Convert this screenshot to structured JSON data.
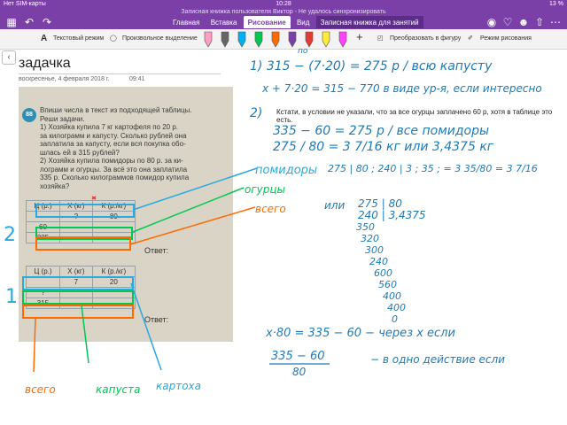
{
  "status": {
    "carrier": "Нет SIM-карты",
    "time": "10:28",
    "battery": "13 %"
  },
  "document": {
    "title": "Записная книжка пользователя Виктор - Не удалось синхронизировать"
  },
  "tabs": [
    "Главная",
    "Вставка",
    "Рисование",
    "Вид",
    "Записная книжка для занятий"
  ],
  "active_tab": "Рисование",
  "ribbon": {
    "text_mode": "Текстовый режим",
    "free_select": "Произвольное выделение",
    "convert": "Преобразовать в фигуру",
    "draw_mode": "Режим рисования"
  },
  "pens": [
    {
      "color": "#ff9fc4"
    },
    {
      "color": "#666666"
    },
    {
      "color": "#00b0f0"
    },
    {
      "color": "#00c853"
    },
    {
      "color": "#ff6a00"
    },
    {
      "color": "#7b3fa8"
    },
    {
      "color": "#e53935"
    },
    {
      "color": "#ffeb3b"
    },
    {
      "color": "#ff40ff"
    }
  ],
  "page": {
    "title": "задачка",
    "date": "воскресенье, 4 февраля 2018 г.",
    "time": "09:41"
  },
  "comment": "Кстати, в условии не указали, что за все огурцы заплачено 60 р, хотя в таблице это есть.",
  "photo": {
    "task_number": "88",
    "task_text": [
      "Впиши числа в текст из подходящей таблицы.",
      "Реши задачи.",
      "1) Хозяйка купила 7 кг картофеля по 20 р.",
      "за килограмм и капусту. Сколько рублей она",
      "заплатила за капусту, если вся покупка обо-",
      "шлась ей в 315 рублей?",
      "2) Хозяйка купила помидоры по 80 р. за ки-",
      "лограмм и огурцы. За всё это она заплатила",
      "335 р. Сколько килограммов помидор купила",
      "хозяйка?"
    ],
    "table_header": [
      "Ц (р.)",
      "Х (кг)",
      "К (р./кг)"
    ],
    "table2": [
      [
        "?",
        "80"
      ],
      [
        "60",
        ""
      ],
      [
        "335",
        ""
      ]
    ],
    "table1": [
      [
        "7",
        "20"
      ],
      [
        "?",
        ""
      ],
      [
        "315",
        ""
      ]
    ],
    "answer_label": "Ответ:"
  },
  "notes": {
    "line1": "1) 315 − (7·20) = 275 р / всю капусту",
    "line1_small": "по",
    "line2": "x + 7·20 = 315 − 770 в виде ур-я, если интересно",
    "label2": "2)",
    "line3": "335 − 60 = 275 р / все помидоры",
    "line4": "275 / 80 = 3 7/16 кг   или   3,4375 кг",
    "fraction_work": "275 | 80 ; 240 | 3 ; 35 ; = 3 35/80 = 3 7/16",
    "long_div_label": "или",
    "long_div": [
      "275 | 80",
      "240 | 3,4375",
      "350",
      "320",
      "300",
      "240",
      "600",
      "560",
      "400",
      "400",
      "0"
    ],
    "line5": "x·80 = 335 − 60 − через x если",
    "line6_num": "335 − 60",
    "line6_den": "80",
    "line6_text": "− в одно действие если",
    "photo_labels": {
      "tomatoes": "помидоры",
      "cucumbers": "огурцы",
      "total": "всего",
      "total2": "всего",
      "cabbage": "капуста",
      "potato": "картоха",
      "two": "2",
      "one": "1"
    }
  }
}
